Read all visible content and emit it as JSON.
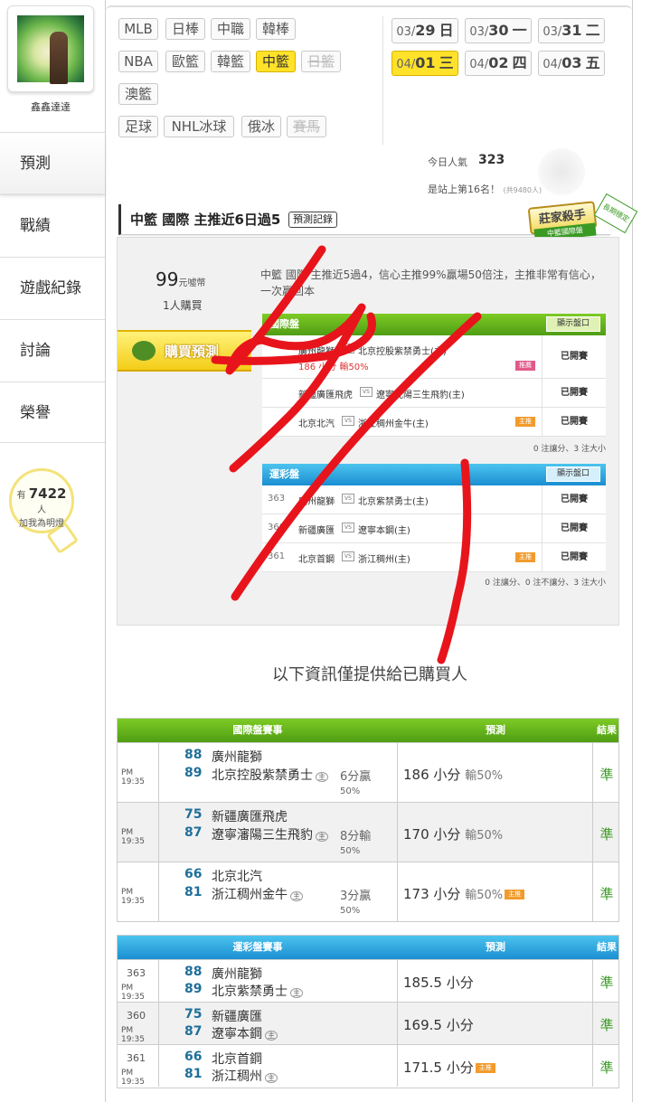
{
  "user": {
    "name": "鑫鑫達達"
  },
  "sidebar": {
    "items": [
      {
        "label": "預測",
        "active": true
      },
      {
        "label": "戰績",
        "active": false
      },
      {
        "label": "遊戲紀錄",
        "active": false
      },
      {
        "label": "討論",
        "active": false
      },
      {
        "label": "榮譽",
        "active": false
      }
    ]
  },
  "fans": {
    "prefix": "有",
    "count": "7422",
    "unit": "人",
    "caption": "加我為明燈"
  },
  "sports": [
    {
      "label": "MLB",
      "state": "normal"
    },
    {
      "label": "日棒",
      "state": "normal"
    },
    {
      "label": "中職",
      "state": "normal"
    },
    {
      "label": "韓棒",
      "state": "normal"
    },
    {
      "label": "NBA",
      "state": "normal"
    },
    {
      "label": "歐籃",
      "state": "normal"
    },
    {
      "label": "韓籃",
      "state": "normal"
    },
    {
      "label": "中籃",
      "state": "selected"
    },
    {
      "label": "日籃",
      "state": "disabled"
    },
    {
      "label": "澳籃",
      "state": "normal"
    },
    {
      "label": "足球",
      "state": "normal"
    },
    {
      "label": "NHL冰球",
      "state": "normal"
    },
    {
      "label": "俄冰",
      "state": "normal"
    },
    {
      "label": "賽馬",
      "state": "disabled"
    }
  ],
  "dates": [
    {
      "md": "03/",
      "d": "29",
      "wd": "日",
      "selected": false
    },
    {
      "md": "03/",
      "d": "30",
      "wd": "一",
      "selected": false
    },
    {
      "md": "03/",
      "d": "31",
      "wd": "二",
      "selected": false
    },
    {
      "md": "04/",
      "d": "01",
      "wd": "三",
      "selected": true
    },
    {
      "md": "04/",
      "d": "02",
      "wd": "四",
      "selected": false
    },
    {
      "md": "04/",
      "d": "03",
      "wd": "五",
      "selected": false
    }
  ],
  "stats": {
    "pop_label": "今日人氣",
    "pop_value": "323",
    "rank_text": "是站上第16名！",
    "rank_total": "(共9480人)"
  },
  "header": {
    "title": "中籃 國際 主推近6日過5",
    "history_button": "預測記錄"
  },
  "badge": {
    "title": "莊家殺手",
    "sub": "中籃國際盤",
    "ribbon": "長期穩定"
  },
  "offer": {
    "price": "99",
    "price_unit": "元噓幣",
    "buyers": "1人購買",
    "description": "中籃 國際 主推近5過4，信心主推99%贏場50倍注，主推非常有信心，一次贏回本",
    "buy_button": "購買預測"
  },
  "intl": {
    "title": "國際盤",
    "show_button": "顯示盤口",
    "rows": [
      {
        "team1": "廣州龍獅",
        "team2": "北京控股紫禁勇士(主)",
        "extra": "186 小分 輸50%",
        "tag": "推薦",
        "status": "已開賽"
      },
      {
        "team1": "新疆廣匯飛虎",
        "team2": "遼寧沈陽三生飛豹(主)",
        "status": "已開賽"
      },
      {
        "team1": "北京北汽",
        "team2": "浙江稠州金牛(主)",
        "tag": "主推",
        "status": "已開賽"
      }
    ],
    "summary": "0 注讓分、3 注大小"
  },
  "lottery": {
    "title": "運彩盤",
    "show_button": "顯示盤口",
    "rows": [
      {
        "code": "363",
        "team1": "廣州龍獅",
        "team2": "北京紫禁勇士(主)",
        "status": "已開賽"
      },
      {
        "code": "360",
        "team1": "新疆廣匯",
        "team2": "遼寧本鋼(主)",
        "status": "已開賽"
      },
      {
        "code": "361",
        "team1": "北京首鋼",
        "team2": "浙江稠州(主)",
        "tag": "主推",
        "status": "已開賽"
      }
    ],
    "summary": "0 注讓分、0 注不讓分、3 注大小"
  },
  "notice": "以下資訊僅提供給已購買人",
  "intl_results": {
    "headers": [
      "國際盤賽事",
      "預測",
      "結果"
    ],
    "rows": [
      {
        "time": "PM 19:35",
        "s1": "88",
        "t1": "廣州龍獅",
        "s2": "89",
        "t2": "北京控股紫禁勇士",
        "host": "主",
        "margin": "6分贏",
        "pct": "50%",
        "pred": "186 小分",
        "pred_extra": "輸50%",
        "tag": "",
        "result": "準"
      },
      {
        "time": "PM 19:35",
        "s1": "75",
        "t1": "新疆廣匯飛虎",
        "s2": "87",
        "t2": "遼寧瀋陽三生飛豹",
        "host": "主",
        "margin": "8分輸",
        "pct": "50%",
        "pred": "170 小分",
        "pred_extra": "輸50%",
        "tag": "",
        "result": "準"
      },
      {
        "time": "PM 19:35",
        "s1": "66",
        "t1": "北京北汽",
        "s2": "81",
        "t2": "浙江稠州金牛",
        "host": "主",
        "margin": "3分贏",
        "pct": "50%",
        "pred": "173 小分",
        "pred_extra": "輸50%",
        "tag": "主推",
        "result": "準"
      }
    ]
  },
  "lottery_results": {
    "headers": [
      "運彩盤賽事",
      "預測",
      "結果"
    ],
    "rows": [
      {
        "code": "363",
        "time": "PM 19:35",
        "s1": "88",
        "t1": "廣州龍獅",
        "s2": "89",
        "t2": "北京紫禁勇士",
        "host": "主",
        "pred": "185.5 小分",
        "tag": "",
        "result": "準"
      },
      {
        "code": "360",
        "time": "PM 19:35",
        "s1": "75",
        "t1": "新疆廣匯",
        "s2": "87",
        "t2": "遼寧本鋼",
        "host": "主",
        "pred": "169.5 小分",
        "tag": "",
        "result": "準"
      },
      {
        "code": "361",
        "time": "PM 19:35",
        "s1": "66",
        "t1": "北京首鋼",
        "s2": "81",
        "t2": "浙江稠州",
        "host": "主",
        "pred": "171.5 小分",
        "tag": "主推",
        "result": "準"
      }
    ]
  },
  "colors": {
    "accent_yellow": "#ffe229",
    "green_header": "#5aa91a",
    "blue_header": "#1a8ed1",
    "scribble_red": "#e8141c",
    "result_green": "#3a9a24"
  }
}
